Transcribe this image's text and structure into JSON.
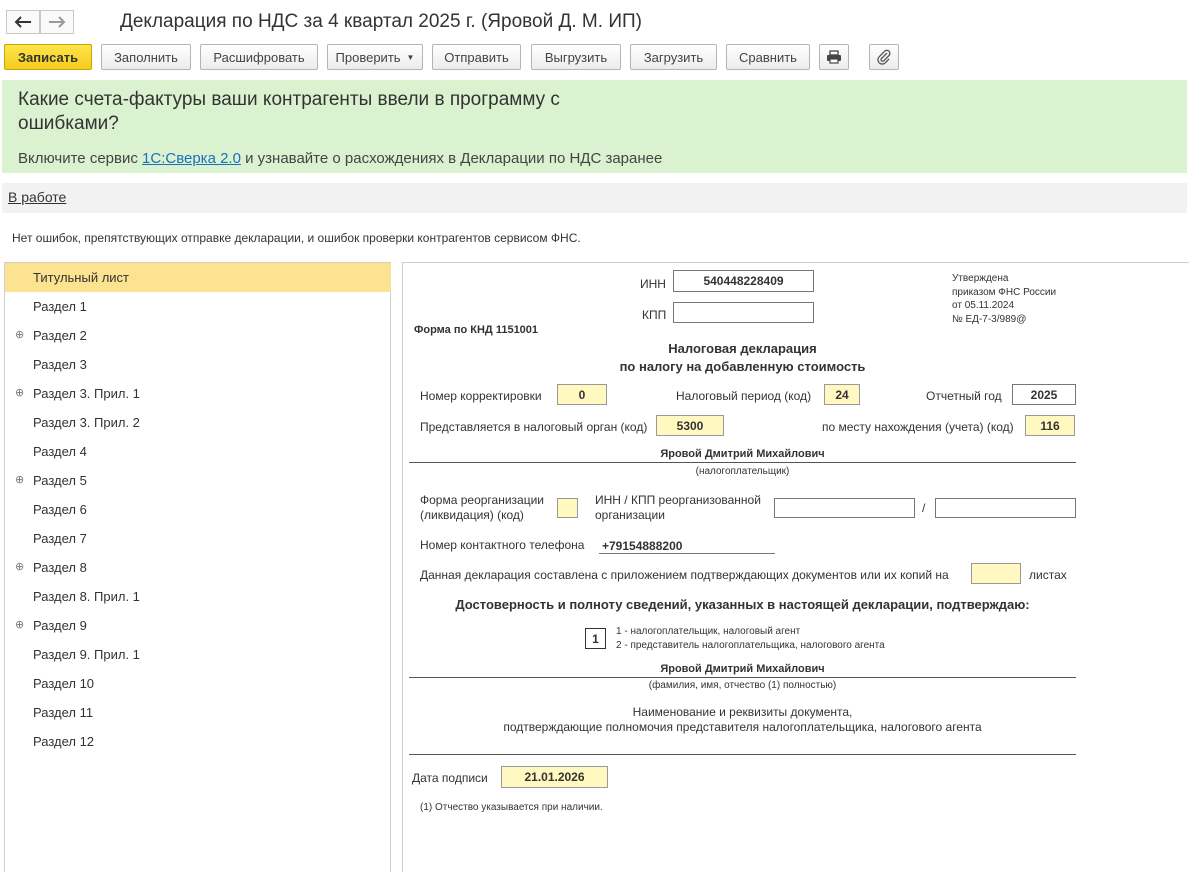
{
  "window": {
    "title": "Декларация по НДС за 4 квартал 2025 г. (Яровой Д. М. ИП)",
    "back_icon": "arrow-left-icon",
    "forward_icon": "arrow-right-icon"
  },
  "toolbar": {
    "save": "Записать",
    "fill": "Заполнить",
    "decode": "Расшифровать",
    "check": "Проверить",
    "send": "Отправить",
    "export": "Выгрузить",
    "import": "Загрузить",
    "compare": "Сравнить",
    "print_icon": "printer-icon",
    "attach_icon": "paperclip-icon"
  },
  "banner": {
    "title": "Какие счета-фактуры ваши контрагенты ввели в программу с ошибками?",
    "text_before": "Включите сервис ",
    "link": "1С:Сверка 2.0",
    "text_after": " и узнавайте о расхождениях в Декларации по НДС заранее"
  },
  "status": {
    "link": "В работе",
    "message": "Нет ошибок, препятствующих отправке декларации, и ошибок проверки контрагентов сервисом ФНС."
  },
  "sidebar": {
    "items": [
      {
        "label": "Титульный лист",
        "expandable": false,
        "selected": true
      },
      {
        "label": "Раздел 1",
        "expandable": false
      },
      {
        "label": "Раздел 2",
        "expandable": true
      },
      {
        "label": "Раздел 3",
        "expandable": false
      },
      {
        "label": "Раздел 3. Прил. 1",
        "expandable": true
      },
      {
        "label": "Раздел 3. Прил. 2",
        "expandable": false
      },
      {
        "label": "Раздел 4",
        "expandable": false
      },
      {
        "label": "Раздел 5",
        "expandable": true
      },
      {
        "label": "Раздел 6",
        "expandable": false
      },
      {
        "label": "Раздел 7",
        "expandable": false
      },
      {
        "label": "Раздел 8",
        "expandable": true
      },
      {
        "label": "Раздел 8. Прил. 1",
        "expandable": false
      },
      {
        "label": "Раздел 9",
        "expandable": true
      },
      {
        "label": "Раздел 9. Прил. 1",
        "expandable": false
      },
      {
        "label": "Раздел 10",
        "expandable": false
      },
      {
        "label": "Раздел 11",
        "expandable": false
      },
      {
        "label": "Раздел 12",
        "expandable": false
      }
    ]
  },
  "form": {
    "inn_label": "ИНН",
    "inn_value": "540448228409",
    "kpp_label": "КПП",
    "kpp_value": "",
    "approved": [
      "Утверждена",
      "приказом ФНС России",
      "от 05.11.2024",
      "№ ЕД-7-3/989@"
    ],
    "form_code": "Форма по КНД 1151001",
    "title_line1": "Налоговая декларация",
    "title_line2": "по налогу на добавленную стоимость",
    "correction_label": "Номер корректировки",
    "correction_value": "0",
    "period_label": "Налоговый период (код)",
    "period_value": "24",
    "year_label": "Отчетный год",
    "year_value": "2025",
    "tax_office_label": "Представляется в налоговый орган (код)",
    "tax_office_value": "5300",
    "location_label": "по месту нахождения (учета) (код)",
    "location_value": "116",
    "taxpayer_name": "Яровой Дмитрий Михайлович",
    "taxpayer_caption": "(налогоплательщик)",
    "reorg_label_1": "Форма реорганизации",
    "reorg_label_2": "(ликвидация) (код)",
    "reorg_value": "",
    "reorg_inn_label_1": "ИНН / КПП реорганизованной",
    "reorg_inn_label_2": "организации",
    "reorg_inn_value": "",
    "slash": "/",
    "reorg_kpp_value": "",
    "phone_label": "Номер контактного телефона",
    "phone_value": "+79154888200",
    "pages_label": "Данная декларация составлена с приложением подтверждающих документов или их копий на",
    "pages_value": "",
    "pages_suffix": "листах",
    "confirm_title": "Достоверность и полноту сведений, указанных в настоящей декларации, подтверждаю:",
    "signer_value": "1",
    "signer_option_1": "1 - налогоплательщик, налоговый агент",
    "signer_option_2": "2 - представитель налогоплательщика, налогового агента",
    "signer_name": "Яровой Дмитрий Михайлович",
    "signer_caption": "(фамилия, имя, отчество (1)  полностью)",
    "doc_line1": "Наименование и реквизиты документа,",
    "doc_line2": "подтверждающие полномочия представителя налогоплательщика, налогового агента",
    "sign_date_label": "Дата подписи",
    "sign_date_value": "21.01.2026",
    "footnote": "(1) Отчество указывается при наличии."
  }
}
